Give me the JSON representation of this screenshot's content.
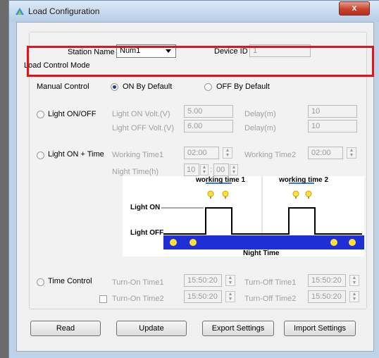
{
  "window": {
    "title": "Load Configuration",
    "close_glyph": "x"
  },
  "top": {
    "station_label": "Station Name",
    "station_value": "Num1",
    "device_label": "Device ID",
    "device_value": "1"
  },
  "load_control_mode": {
    "group_label": "Load Control Mode",
    "manual_label": "Manual Control",
    "on_default_label": "ON By Default",
    "off_default_label": "OFF By Default",
    "selected": "ON By Default"
  },
  "light_onoff": {
    "label": "Light ON/OFF",
    "on_volt_label": "Light ON  Volt.(V)",
    "on_volt_value": "5.00",
    "off_volt_label": "Light OFF Volt.(V)",
    "off_volt_value": "6.00",
    "delay_label_1": "Delay(m)",
    "delay_value_1": "10",
    "delay_label_2": "Delay(m)",
    "delay_value_2": "10"
  },
  "light_on_time": {
    "label": "Light ON + Time",
    "working_time1_label": "Working Time1",
    "working_time1_value": "02:00",
    "working_time2_label": "Working Time2",
    "working_time2_value": "02:00",
    "night_time_label": "Night Time(h)",
    "night_hours": "10",
    "night_minutes": "00",
    "separator": ":"
  },
  "diagram": {
    "working_time_1": "working time 1",
    "working_time_2": "working time 2",
    "light_on": "Light ON",
    "light_off": "Light OFF",
    "night_time": "Night Time",
    "colors": {
      "band": "#1f2fd6",
      "sun": "#ffe033",
      "moon": "#ffd500",
      "line": "#000000"
    }
  },
  "time_control": {
    "label": "Time Control",
    "turn_on_1_label": "Turn-On Time1",
    "turn_on_1_value": "15:50:20",
    "turn_off_1_label": "Turn-Off Time1",
    "turn_off_1_value": "15:50:20",
    "turn_on_2_label": "Turn-On Time2",
    "turn_on_2_value": "15:50:20",
    "turn_off_2_label": "Turn-Off Time2",
    "turn_off_2_value": "15:50:20"
  },
  "buttons": {
    "read": "Read",
    "update": "Update",
    "export": "Export Settings",
    "import": "Import Settings"
  },
  "icons": {
    "spin_up": "▲",
    "spin_down": "▼"
  }
}
